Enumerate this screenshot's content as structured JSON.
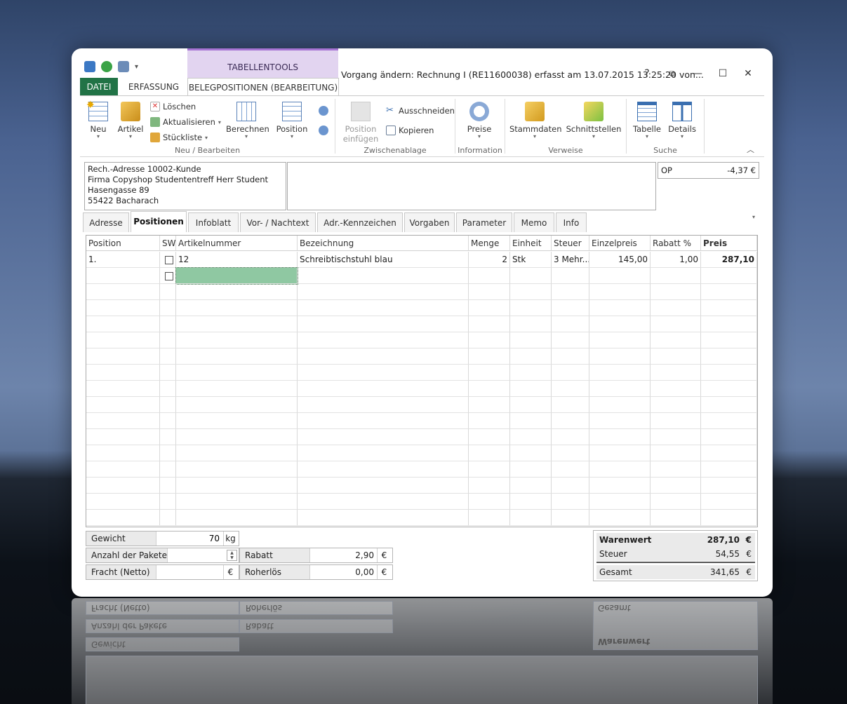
{
  "window": {
    "title": "Vorgang ändern: Rechnung I (RE11600038) erfasst am 13.07.2015 13:25:20 von...",
    "context_tab": "TABELLENTOOLS",
    "help": "?",
    "restore": "⧉",
    "minimize": "—",
    "maximize": "☐",
    "close": "✕"
  },
  "ribbon_tabs": {
    "file": "DATEI",
    "erfassung": "ERFASSUNG",
    "belegpositionen": "BELEGPOSITIONEN (BEARBEITUNG)"
  },
  "ribbon": {
    "neu": "Neu",
    "artikel": "Artikel",
    "loeschen": "Löschen",
    "aktualisieren": "Aktualisieren",
    "stueckliste": "Stückliste",
    "berechnen": "Berechnen",
    "position": "Position",
    "group_neu": "Neu / Bearbeiten",
    "position_einfuegen_1": "Position",
    "position_einfuegen_2": "einfügen",
    "ausschneiden": "Ausschneiden",
    "kopieren": "Kopieren",
    "group_zwischenablage": "Zwischenablage",
    "preise": "Preise",
    "group_information": "Information",
    "stammdaten": "Stammdaten",
    "schnittstellen": "Schnittstellen",
    "group_verweise": "Verweise",
    "tabelle": "Tabelle",
    "details": "Details",
    "group_suche": "Suche"
  },
  "address": {
    "line1": "Rech.-Adresse 10002-Kunde",
    "line2": "Firma Copyshop Studententreff Herr Student",
    "line3": "Hasengasse 89",
    "line4": "55422 Bacharach"
  },
  "op": {
    "label": "OP",
    "value": "-4,37 €"
  },
  "tabs": [
    "Adresse",
    "Positionen",
    "Infoblatt",
    "Vor- / Nachtext",
    "Adr.-Kennzeichen",
    "Vorgaben",
    "Parameter",
    "Memo",
    "Info"
  ],
  "grid": {
    "headers": [
      "Position",
      "SW",
      "Artikelnummer",
      "Bezeichnung",
      "Menge",
      "Einheit",
      "Steuer",
      "Einzelpreis",
      "Rabatt %",
      "Preis"
    ],
    "row1": {
      "position": "1.",
      "artikelnummer": "12",
      "bezeichnung": "Schreibtischstuhl blau",
      "menge": "2",
      "einheit": "Stk",
      "steuer": "3 Mehr...",
      "einzelpreis": "145,00",
      "rabatt": "1,00",
      "preis": "287,10"
    }
  },
  "footer": {
    "gewicht_label": "Gewicht",
    "gewicht_value": "70",
    "gewicht_unit": "kg",
    "pakete_label": "Anzahl der Pakete",
    "fracht_label": "Fracht (Netto)",
    "fracht_unit": "€",
    "rabatt_label": "Rabatt",
    "rabatt_value": "2,90",
    "rabatt_unit": "€",
    "roherloes_label": "Roherlös",
    "roherloes_value": "0,00",
    "roherloes_unit": "€",
    "warenwert_label": "Warenwert",
    "warenwert_value": "287,10",
    "steuer_label": "Steuer",
    "steuer_value": "54,55",
    "gesamt_label": "Gesamt",
    "gesamt_value": "341,65",
    "currency": "€"
  }
}
